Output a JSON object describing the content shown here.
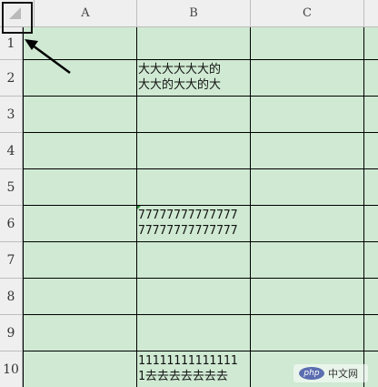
{
  "sheet": {
    "columns": [
      "A",
      "B",
      "C"
    ],
    "rows": [
      "1",
      "2",
      "3",
      "4",
      "5",
      "6",
      "7",
      "8",
      "9",
      "10"
    ]
  },
  "cells": {
    "B2": [
      "大大大大大大的",
      "大大的大大的大"
    ],
    "B6": [
      "77777777777777",
      "77777777777777"
    ],
    "B10": [
      "11111111111111",
      "1去去去去去去去"
    ]
  },
  "watermark": {
    "logo": "php",
    "text": "中文网"
  },
  "colors": {
    "cell_background": "#cfe9d2",
    "header_background": "#efefef",
    "grid": "#000000"
  }
}
